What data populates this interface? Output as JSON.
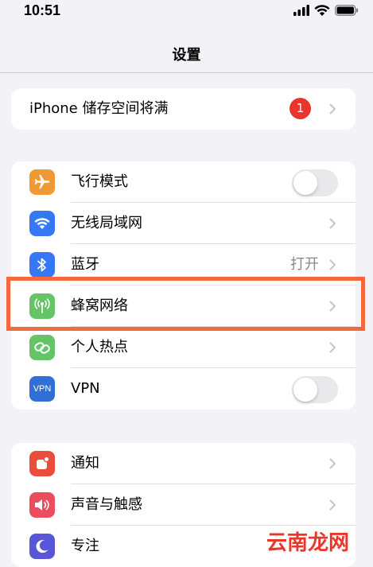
{
  "status": {
    "time": "10:51"
  },
  "nav": {
    "title": "设置"
  },
  "storage_alert": {
    "label": "iPhone 储存空间将满",
    "badge": "1"
  },
  "connectivity": [
    {
      "key": "airplane",
      "label": "飞行模式",
      "icon": "airplane-icon",
      "color": "#f09a37",
      "accessory": "toggle",
      "toggle_on": false
    },
    {
      "key": "wifi",
      "label": "无线局域网",
      "icon": "wifi-icon",
      "color": "#3478f6",
      "accessory": "chevron"
    },
    {
      "key": "bluetooth",
      "label": "蓝牙",
      "icon": "bluetooth-icon",
      "color": "#3478f6",
      "accessory": "chevron",
      "value": "打开"
    },
    {
      "key": "cellular",
      "label": "蜂窝网络",
      "icon": "antenna-icon",
      "color": "#65c466",
      "accessory": "chevron"
    },
    {
      "key": "hotspot",
      "label": "个人热点",
      "icon": "link-icon",
      "color": "#65c466",
      "accessory": "chevron"
    },
    {
      "key": "vpn",
      "label": "VPN",
      "icon": "vpn-icon",
      "icon_text": "VPN",
      "color": "#2f6fd6",
      "accessory": "toggle",
      "toggle_on": false
    }
  ],
  "notifications_group": [
    {
      "key": "notifications",
      "label": "通知",
      "icon": "bell-icon",
      "color": "#eb4d3d"
    },
    {
      "key": "sounds",
      "label": "声音与触感",
      "icon": "speaker-icon",
      "color": "#eb4d5f"
    },
    {
      "key": "focus",
      "label": "专注",
      "icon": "moon-icon",
      "color": "#5856d6"
    }
  ],
  "watermark": "云南龙网"
}
